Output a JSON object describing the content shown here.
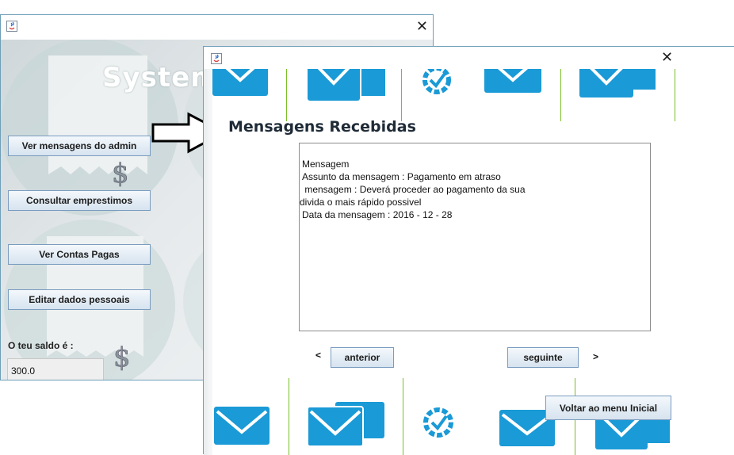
{
  "window_main": {
    "app_title": "System",
    "buttons": {
      "view_admin_messages": "Ver mensagens do admin",
      "check_loans": "Consultar emprestimos",
      "view_paid_bills": "Ver Contas Pagas",
      "edit_personal_data": "Editar dados pessoais"
    },
    "balance_label": "O teu saldo é :",
    "balance_value": "300.0"
  },
  "window_messages": {
    "heading": "Mensagens Recebidas",
    "message": {
      "line1": "Mensagem",
      "line2": "Assunto da mensagem : Pagamento em atraso",
      "line3": " mensagem : Deverá proceder ao pagamento da sua",
      "line4": "divida o mais rápido possivel",
      "line5": "Data da mensagem : 2016 - 12 - 28"
    },
    "prev_symbol": "<",
    "prev_button": "anterior",
    "next_button": "seguinte",
    "next_symbol": ">",
    "back_button": "Voltar ao menu Inicial"
  },
  "colors": {
    "icon_blue": "#1a9ad6",
    "divider_green": "#7bbf2a",
    "button_border": "#7a9cbf"
  },
  "icons": [
    "java-app-icon",
    "close-icon",
    "envelope-icon",
    "multi-envelope-icon",
    "sync-check-icon",
    "dollar-icon",
    "arrow-annotation-icon"
  ]
}
